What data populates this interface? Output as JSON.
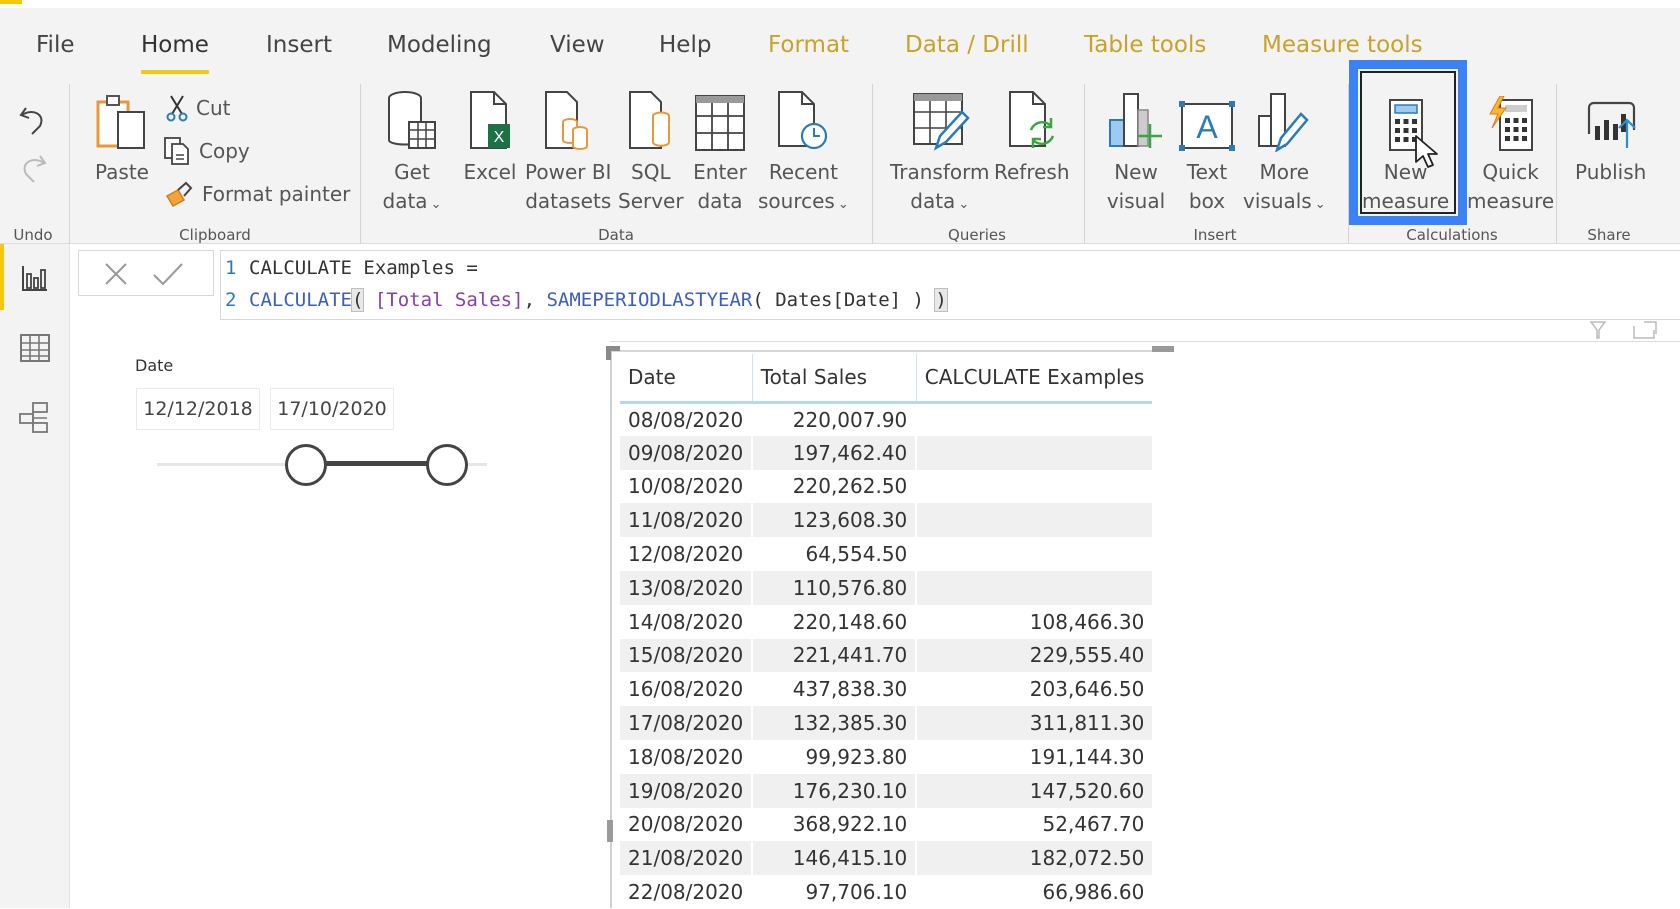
{
  "ribbon": {
    "tabs": [
      {
        "label": "File",
        "active": false,
        "contextual": false
      },
      {
        "label": "Home",
        "active": true,
        "contextual": false
      },
      {
        "label": "Insert",
        "active": false,
        "contextual": false
      },
      {
        "label": "Modeling",
        "active": false,
        "contextual": false
      },
      {
        "label": "View",
        "active": false,
        "contextual": false
      },
      {
        "label": "Help",
        "active": false,
        "contextual": false
      },
      {
        "label": "Format",
        "active": false,
        "contextual": true
      },
      {
        "label": "Data / Drill",
        "active": false,
        "contextual": true
      },
      {
        "label": "Table tools",
        "active": false,
        "contextual": true
      },
      {
        "label": "Measure tools",
        "active": false,
        "contextual": true
      }
    ],
    "groups": {
      "undo": {
        "label": "Undo",
        "undo_icon": "undo-icon",
        "redo_icon": "redo-icon"
      },
      "clipboard": {
        "label": "Clipboard",
        "paste": "Paste",
        "cut": "Cut",
        "copy": "Copy",
        "format_painter": "Format painter"
      },
      "data": {
        "label": "Data",
        "get_data": [
          "Get",
          "data"
        ],
        "excel": "Excel",
        "power_bi_datasets": [
          "Power BI",
          "datasets"
        ],
        "sql_server": [
          "SQL",
          "Server"
        ],
        "enter_data": [
          "Enter",
          "data"
        ],
        "recent_sources": [
          "Recent",
          "sources"
        ]
      },
      "queries": {
        "label": "Queries",
        "transform_data": [
          "Transform",
          "data"
        ],
        "refresh": "Refresh"
      },
      "insert": {
        "label": "Insert",
        "new_visual": [
          "New",
          "visual"
        ],
        "text_box": [
          "Text",
          "box"
        ],
        "more_visuals": [
          "More",
          "visuals"
        ]
      },
      "calculations": {
        "label": "Calculations",
        "new_measure": [
          "New",
          "measure"
        ],
        "quick_measure": [
          "Quick",
          "measure"
        ]
      },
      "share": {
        "label": "Share",
        "publish": "Publish"
      }
    },
    "highlight_color": "#3b82f6",
    "active_tab_color": "#f2c811",
    "context_tab_color": "#c9a227"
  },
  "formula_bar": {
    "line1_num": "1",
    "line1_text": "CALCULATE Examples =",
    "line2_num": "2",
    "line2": {
      "fn1": "CALCULATE",
      "open1": "(",
      "measure": " [Total Sales]",
      "sep": ", ",
      "fn2": "SAMEPERIODLASTYEAR",
      "arg": "( Dates[Date] ) ",
      "close1": ")"
    }
  },
  "left_nav": {
    "items": [
      {
        "name": "report-view",
        "active": true
      },
      {
        "name": "data-view",
        "active": false
      },
      {
        "name": "model-view",
        "active": false
      }
    ]
  },
  "slicer": {
    "title": "Date",
    "start_date": "12/12/2018",
    "end_date": "17/10/2020",
    "range_start_fraction": 0.45,
    "range_end_fraction": 0.88
  },
  "table": {
    "columns": [
      "Date",
      "Total Sales",
      "CALCULATE Examples"
    ],
    "rows": [
      [
        "08/08/2020",
        "220,007.90",
        ""
      ],
      [
        "09/08/2020",
        "197,462.40",
        ""
      ],
      [
        "10/08/2020",
        "220,262.50",
        ""
      ],
      [
        "11/08/2020",
        "123,608.30",
        ""
      ],
      [
        "12/08/2020",
        "64,554.50",
        ""
      ],
      [
        "13/08/2020",
        "110,576.80",
        ""
      ],
      [
        "14/08/2020",
        "220,148.60",
        "108,466.30"
      ],
      [
        "15/08/2020",
        "221,441.70",
        "229,555.40"
      ],
      [
        "16/08/2020",
        "437,838.30",
        "203,646.50"
      ],
      [
        "17/08/2020",
        "132,385.30",
        "311,811.30"
      ],
      [
        "18/08/2020",
        "99,923.80",
        "191,144.30"
      ],
      [
        "19/08/2020",
        "176,230.10",
        "147,520.60"
      ],
      [
        "20/08/2020",
        "368,922.10",
        "52,467.70"
      ],
      [
        "21/08/2020",
        "146,415.10",
        "182,072.50"
      ],
      [
        "22/08/2020",
        "97,706.10",
        "66,986.60"
      ]
    ]
  }
}
